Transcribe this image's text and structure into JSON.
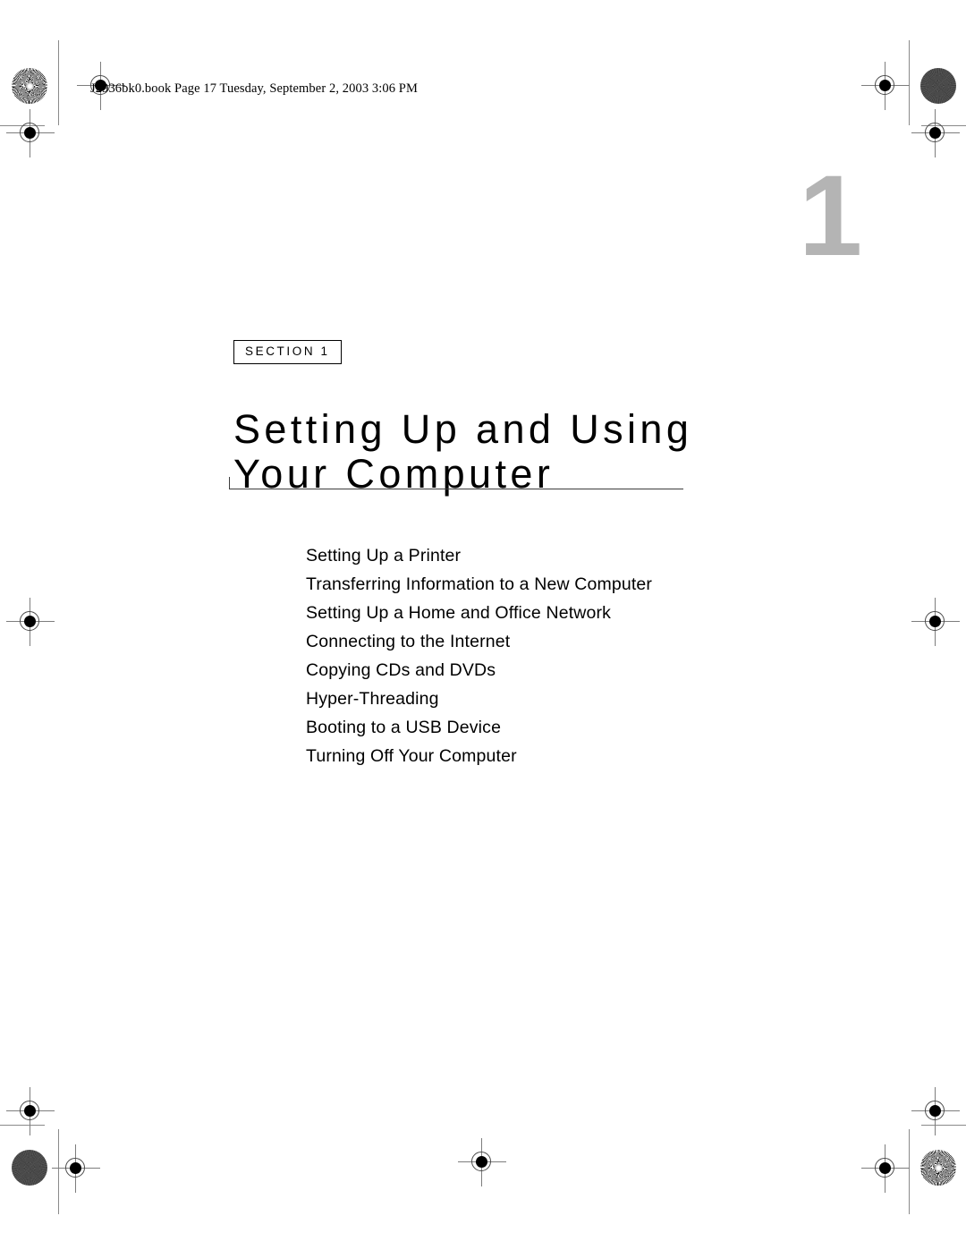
{
  "header": {
    "running_header": "J2936bk0.book  Page 17  Tuesday, September 2, 2003  3:06 PM"
  },
  "chapter": {
    "number": "1",
    "section_badge": "SECTION 1",
    "title": "Setting Up and Using\nYour Computer"
  },
  "contents": {
    "items": [
      "Setting Up a Printer",
      "Transferring Information to a New Computer",
      "Setting Up a Home and Office Network",
      "Connecting to the Internet",
      "Copying CDs and DVDs",
      "Hyper-Threading",
      "Booting to a USB Device",
      "Turning Off Your Computer"
    ]
  },
  "print_marks": {
    "starburst_label": "starburst-registration-patch",
    "density_label": "solid-density-patch",
    "target_label": "registration-target"
  },
  "colors": {
    "chapter_number": "#b4b4b4",
    "rule": "#3d3d3d",
    "trim_line": "#8a8a8a",
    "text": "#000000"
  }
}
